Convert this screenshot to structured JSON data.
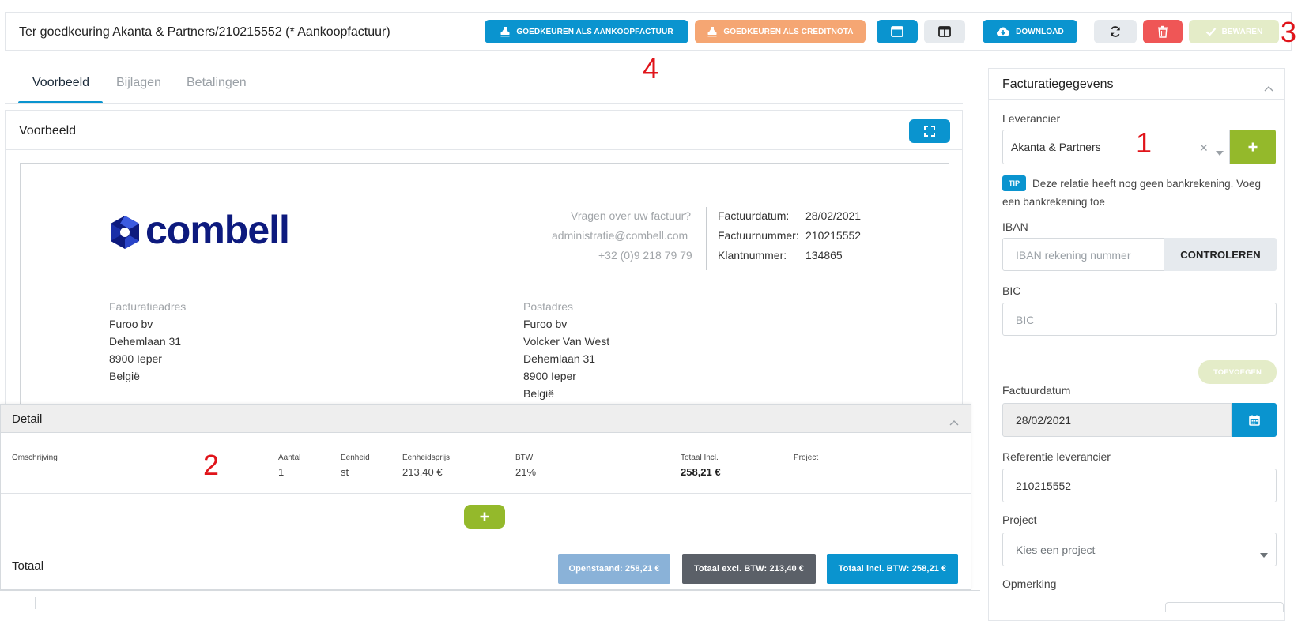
{
  "header": {
    "title": "Ter goedkeuring Akanta & Partners/210215552 (* Aankoopfactuur)",
    "approve_purchase_label": "GOEDKEUREN ALS AANKOOPFACTUUR",
    "approve_credit_label": "GOEDKEUREN ALS CREDITNOTA",
    "download_label": "DOWNLOAD",
    "save_label": "BEWAREN"
  },
  "markers": {
    "m1": "1",
    "m2": "2",
    "m3": "3",
    "m4": "4"
  },
  "tabs": [
    {
      "label": "Voorbeeld",
      "active": true
    },
    {
      "label": "Bijlagen",
      "active": false
    },
    {
      "label": "Betalingen",
      "active": false
    }
  ],
  "preview": {
    "title": "Voorbeeld",
    "logo_text": "combell",
    "question": "Vragen over uw factuur?",
    "email": "administratie@combell.com",
    "phone": "+32 (0)9 218 79 79",
    "meta": [
      {
        "label": "Factuurdatum:",
        "value": "28/02/2021"
      },
      {
        "label": "Factuurnummer:",
        "value": "210215552"
      },
      {
        "label": "Klantnummer:",
        "value": "134865"
      }
    ],
    "billing": {
      "heading": "Facturatieadres",
      "lines": [
        "Furoo bv",
        "Dehemlaan 31",
        "8900 Ieper",
        "België"
      ]
    },
    "postal": {
      "heading": "Postadres",
      "lines": [
        "Furoo bv",
        "Volcker Van West",
        "Dehemlaan 31",
        "8900 Ieper",
        "België"
      ]
    }
  },
  "detail": {
    "title": "Detail",
    "columns": [
      "Omschrijving",
      "Aantal",
      "Eenheid",
      "Eenheidsprijs",
      "BTW",
      "Totaal Incl.",
      "Project"
    ],
    "row": {
      "aantal": "1",
      "eenheid": "st",
      "eenheidsprijs": "213,40 €",
      "btw": "21%",
      "totaal": "258,21 €"
    },
    "totals_label": "Totaal",
    "open": "Openstaand: 258,21 €",
    "excl": "Totaal excl. BTW: 213,40 €",
    "incl": "Totaal incl. BTW: 258,21 €"
  },
  "sidebar": {
    "title": "Facturatiegegevens",
    "supplier_label": "Leverancier",
    "supplier_value": "Akanta & Partners",
    "tip_badge": "TIP",
    "tip_line1": "Deze relatie heeft nog geen bankrekening. Voeg",
    "tip_line2": "een bankrekening toe",
    "iban_label": "IBAN",
    "iban_placeholder": "IBAN rekening nummer",
    "check_label": "CONTROLEREN",
    "bic_label": "BIC",
    "bic_placeholder": "BIC",
    "add_label": "TOEVOEGEN",
    "date_label": "Factuurdatum",
    "date_value": "28/02/2021",
    "ref_label": "Referentie leverancier",
    "ref_value": "210215552",
    "project_label": "Project",
    "project_placeholder": "Kies een project",
    "remark_label": "Opmerking"
  },
  "colors": {
    "accent": "#0a94cf",
    "orange": "#f5a673",
    "green": "#94b92b",
    "red": "#ef5656",
    "logo": "#0d1a7e"
  }
}
